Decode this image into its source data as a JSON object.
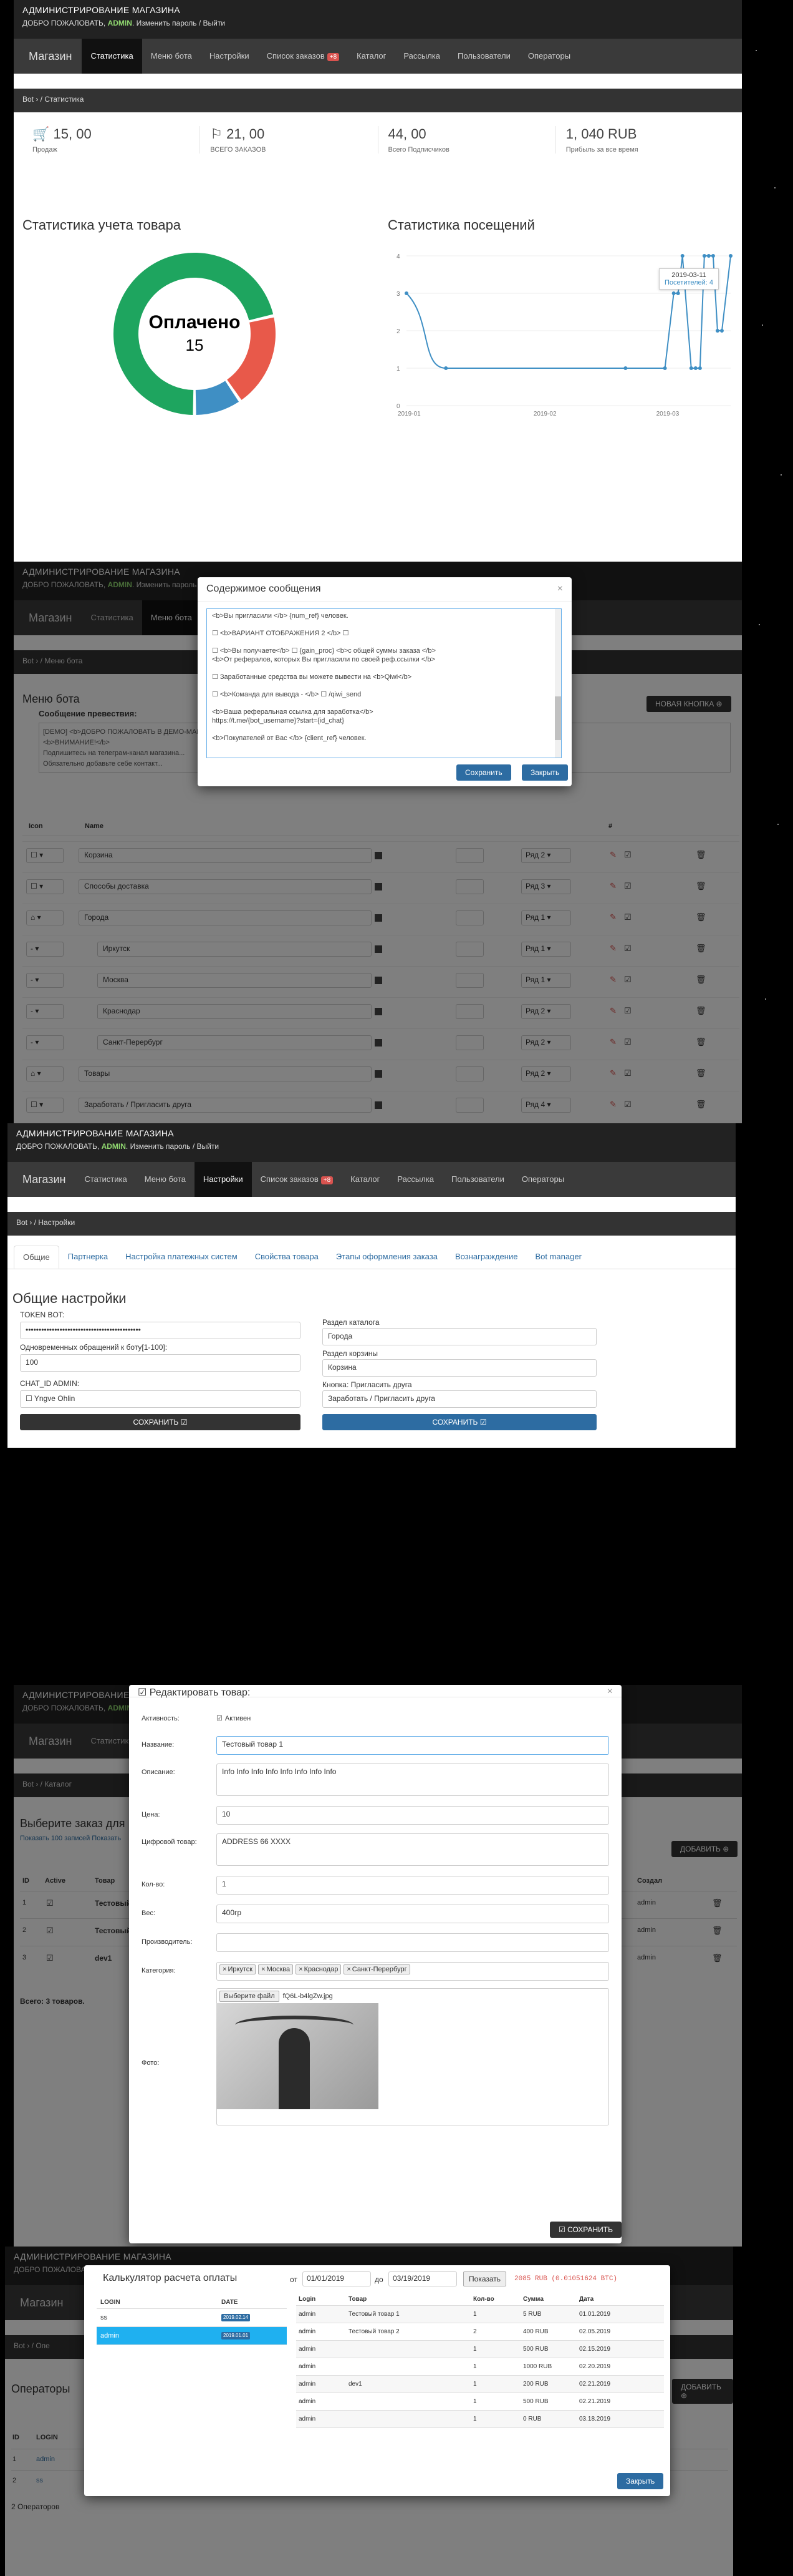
{
  "header": {
    "title": "АДМИНИСТРИРОВАНИЕ МАГАЗИНА",
    "welcome": "ДОБРО ПОЖАЛОВАТЬ,",
    "user": "ADMIN",
    "links": "Изменить пароль / Выйти"
  },
  "nav": {
    "brand": "Магазин",
    "items": [
      "Статистика",
      "Меню бота",
      "Настройки",
      "Список заказов",
      "Каталог",
      "Рассылка",
      "Пользователи",
      "Операторы"
    ],
    "badge": "+8"
  },
  "p1": {
    "crumb": "Bot ›  /  Статистика",
    "stats": [
      {
        "icon": "cart-icon",
        "value": "15, 00",
        "label": "Продаж"
      },
      {
        "icon": "flag-icon",
        "value": "21, 00",
        "label": "ВСЕГО ЗАКАЗОВ"
      },
      {
        "icon": "",
        "value": "44, 00",
        "label": "Всего Подписчиков"
      },
      {
        "icon": "",
        "value": "1, 040 RUB",
        "label": "Прибыль за все время"
      }
    ],
    "donut_title": "Статистика учета товара",
    "donut_center": "Оплачено",
    "donut_value": "15",
    "line_title": "Статистика посещений",
    "tooltip_date": "2019-03-11",
    "tooltip_value": "Посетителей: 4"
  },
  "chart_data": [
    {
      "type": "pie",
      "title": "Статистика учета товара",
      "labels": [
        "Оплачено",
        "",
        ""
      ],
      "values": [
        15,
        4,
        2
      ],
      "colors": [
        "#1ea55f",
        "#e8594a",
        "#3f8fc4"
      ]
    },
    {
      "type": "line",
      "title": "Статистика посещений",
      "x": [
        "2019-01-01",
        "2019-01-10",
        "2019-02-20",
        "2019-03-01",
        "2019-03-03",
        "2019-03-04",
        "2019-03-05",
        "2019-03-07",
        "2019-03-08",
        "2019-03-09",
        "2019-03-10",
        "2019-03-11",
        "2019-03-12",
        "2019-03-13",
        "2019-03-14",
        "2019-03-16"
      ],
      "y": [
        3,
        1,
        1,
        1,
        3,
        3,
        4,
        1,
        1,
        1,
        4,
        4,
        4,
        2,
        2,
        4
      ],
      "yticks": [
        "0",
        "1",
        "2",
        "3",
        "4"
      ],
      "xticks": [
        "2019-01",
        "2019-02",
        "2019-03"
      ],
      "ylim": [
        0,
        4
      ]
    }
  ],
  "p2": {
    "crumb": "Bot ›  /  Меню бота",
    "title": "Меню бота",
    "subtitle": "Сообщение превествия:",
    "new_btn": "НОВАЯ КНОПКА ⊕",
    "welcome_lines": [
      "[DEMO] <b>ДОБРО ПОЖАЛОВАТЬ В ДЕМО-МАГАЗИН</b>",
      "<b>ВНИМАНИЕ!</b>",
      "Подпишитесь на телеграм-канал магазина...",
      "Обязательно добавьте себе контакт..."
    ],
    "cols": [
      "Icon",
      "Name",
      "",
      "",
      "",
      "",
      "#"
    ],
    "rows": [
      {
        "icon": "☐",
        "name": "Корзина",
        "row": "Ряд 2"
      },
      {
        "icon": "☐",
        "name": "Способы доставка",
        "row": "Ряд 3"
      },
      {
        "icon": "⌂",
        "name": "Города",
        "row": "Ряд 1"
      },
      {
        "icon": "-",
        "name": "Иркутск",
        "row": "Ряд 1"
      },
      {
        "icon": "-",
        "name": "Москва",
        "row": "Ряд 1"
      },
      {
        "icon": "-",
        "name": "Краснодар",
        "row": "Ряд 2"
      },
      {
        "icon": "-",
        "name": "Санкт-Перербург",
        "row": "Ряд 2"
      },
      {
        "icon": "⌂",
        "name": "Товары",
        "row": "Ряд 2"
      },
      {
        "icon": "☐",
        "name": "Заработать / Пригласить друга",
        "row": "Ряд 4"
      }
    ],
    "modal_title": "Содержимое сообщения",
    "modal_lines": [
      "<b>Вы пригласили </b> {num_ref} человек.",
      "",
      "☐ <b>ВАРИАНТ ОТОБРАЖЕНИЯ 2 </b> ☐",
      "",
      "☐ <b>Вы получаете</b> ☐ {gain_proc} <b>с общей суммы заказа </b>",
      "<b>От рефералов, которых Вы пригласили по своей реф.ссылки </b>",
      "",
      "☐ Заработанные средства вы можете вывести на <b>Qiwi</b>",
      "",
      "☐ <b>Команда для вывода - </b> ☐ /qiwi_send",
      "",
      "<b>Ваша реферальная ссылка для заработка</b>",
      "https://t.me/{bot_username}?start={id_chat}",
      "",
      "<b>Покупателей от Вас </b> {client_ref} человек."
    ],
    "save": "Сохранить",
    "close": "Закрыть"
  },
  "p3": {
    "crumb": "Bot ›  /  Настройки",
    "tabs": [
      "Общие",
      "Партнерка",
      "Настройка платежных систем",
      "Свойства товара",
      "Этапы оформления заказа",
      "Вознаграждение",
      "Bot manager"
    ],
    "title": "Общие настройки",
    "token_label": "TOKEN BOT:",
    "token_value": "••••••••••••••••••••••••••••••••••••••••••••",
    "limit_label": "Одновременных обращений к боту[1-100]:",
    "limit_value": "100",
    "chat_label": "CHAT_ID ADMIN:",
    "chat_value": "☐ Yngve Ohlin",
    "save": "СОХРАНИТЬ ☑",
    "catalog_label": "Раздел каталога",
    "catalog_value": "Города",
    "cart_label": "Раздел корзины",
    "cart_value": "Корзина",
    "invite_label": "Кнопка: Пригласить друга",
    "invite_value": "Заработать / Пригласить друга",
    "save2": "СОХРАНИТЬ ☑"
  },
  "p4": {
    "crumb": "Bot ›  /  Каталог",
    "heading": "Выберите заказ для",
    "sub": "Показать 100 записей Показать",
    "add_btn": "ДОБАВИТЬ ⊕",
    "cols": [
      "ID",
      "Active",
      "Товар",
      "Создал"
    ],
    "rows": [
      {
        "id": "1",
        "name": "Тестовый",
        "by": "admin"
      },
      {
        "id": "2",
        "name": "Тестовый",
        "by": "admin"
      },
      {
        "id": "3",
        "name": "dev1",
        "by": "admin"
      }
    ],
    "total": "Всего: 3 товаров.",
    "modal_title": "☑ Редактировать товар:",
    "active_label": "Активность:",
    "active_value": "Активен",
    "name_label": "Название:",
    "name_value": "Тестовый товар 1",
    "desc_label": "Описание:",
    "desc_value": "Info Info Info Info Info Info Info Info",
    "price_label": "Цена:",
    "price_value": "10",
    "digital_label": "Цифровой товар:",
    "digital_value": "ADDRESS 66 XXXX",
    "qty_label": "Кол-во:",
    "qty_value": "1",
    "weight_label": "Вес:",
    "weight_value": "400гр",
    "maker_label": "Производитель:",
    "maker_value": "",
    "cat_label": "Категория:",
    "cats": [
      "Иркутск",
      "Москва",
      "Краснодар",
      "Санкт-Перербург"
    ],
    "file_btn": "Выберите файл",
    "file_name": "fQ6L-b4lgZw.jpg",
    "photo_label": "Фото:",
    "save": "☑ СОХРАНИТЬ"
  },
  "p5": {
    "crumb": "Bot ›  /  Опе",
    "heading": "Операторы",
    "add_btn": "ДОБАВИТЬ ⊕",
    "cols": [
      "ID",
      "LOGIN"
    ],
    "rows": [
      {
        "id": "1",
        "login": "admin"
      },
      {
        "id": "2",
        "login": "ss"
      }
    ],
    "total": "2 Операторов",
    "modal_title": "Калькулятор расчета оплаты",
    "from_label": "от",
    "from_date": "01/01/2019",
    "to_label": "до",
    "to_date": "03/19/2019",
    "show_btn": "Показать",
    "sum_text": "2085 RUB (0.01051624 BTC)",
    "left_cols": [
      "LOGIN",
      "DATE"
    ],
    "left_rows": [
      {
        "login": "ss",
        "date": "2019.02.14"
      },
      {
        "login": "admin",
        "date": "2019.01.01"
      }
    ],
    "right_cols": [
      "Login",
      "Товар",
      "Кол-во",
      "Сумма",
      "Дата"
    ],
    "right_rows": [
      {
        "login": "admin",
        "item": "Тестовый товар 1",
        "qty": "1",
        "sum": "5 RUB",
        "date": "01.01.2019"
      },
      {
        "login": "admin",
        "item": "Тестовый товар 2",
        "qty": "2",
        "sum": "400 RUB",
        "date": "02.05.2019"
      },
      {
        "login": "admin",
        "item": "",
        "qty": "1",
        "sum": "500 RUB",
        "date": "02.15.2019"
      },
      {
        "login": "admin",
        "item": "",
        "qty": "1",
        "sum": "1000 RUB",
        "date": "02.20.2019"
      },
      {
        "login": "admin",
        "item": "dev1",
        "qty": "1",
        "sum": "200 RUB",
        "date": "02.21.2019"
      },
      {
        "login": "admin",
        "item": "",
        "qty": "1",
        "sum": "500 RUB",
        "date": "02.21.2019"
      },
      {
        "login": "admin",
        "item": "",
        "qty": "1",
        "sum": "0 RUB",
        "date": "03.18.2019"
      }
    ],
    "close": "Закрыть"
  }
}
